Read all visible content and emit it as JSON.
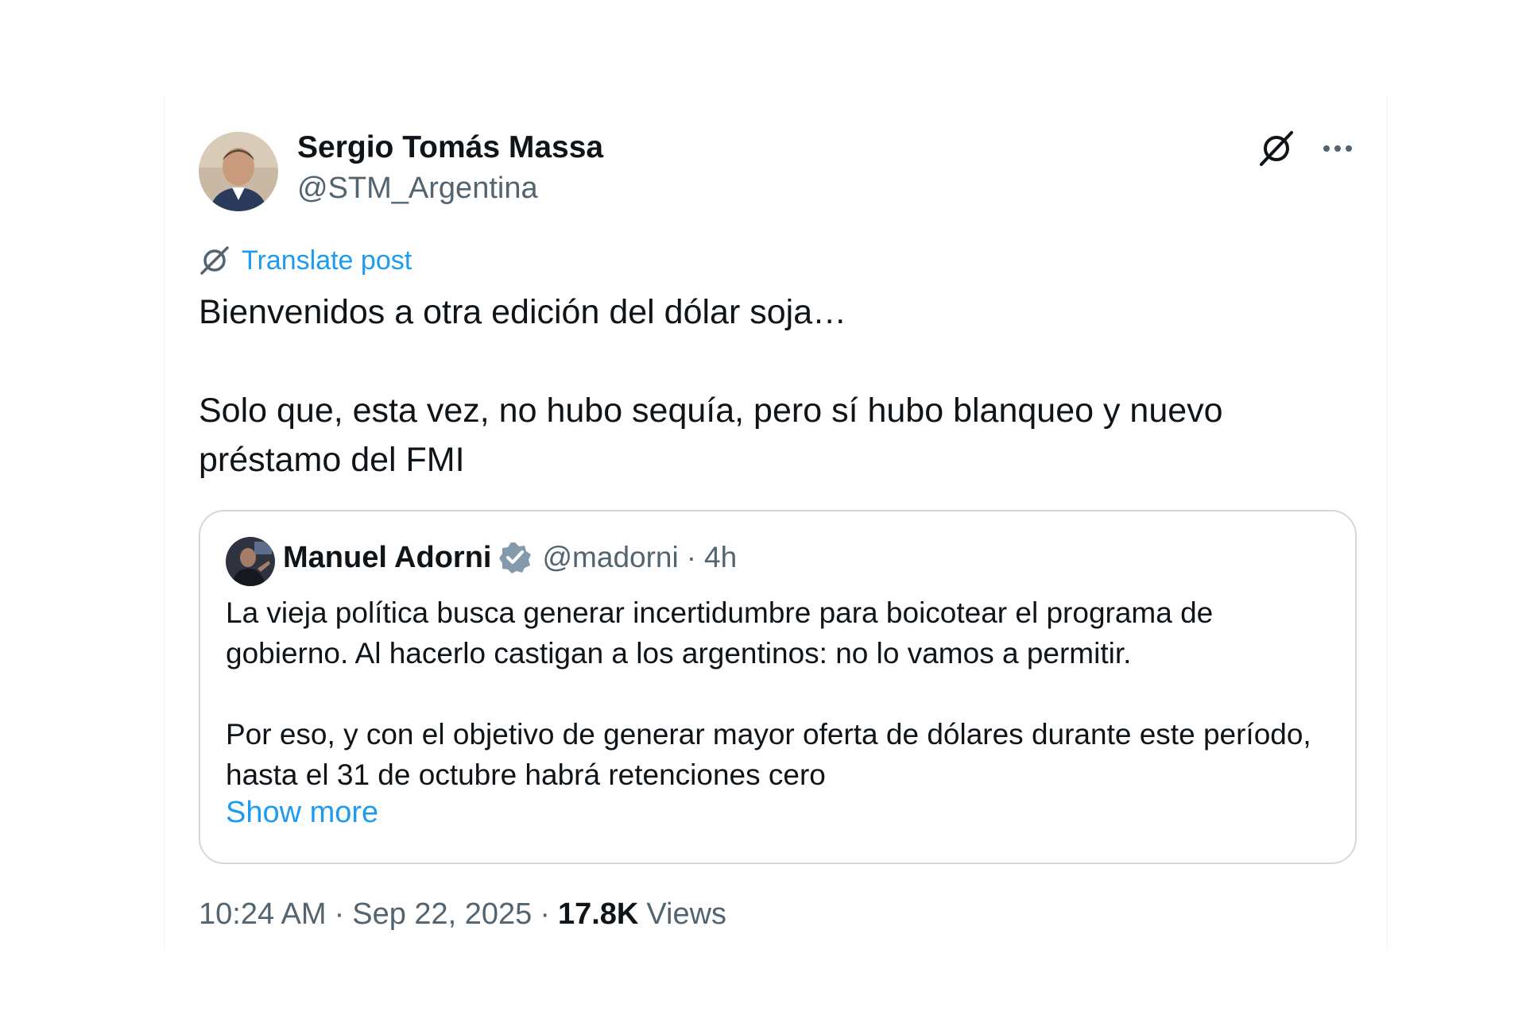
{
  "post": {
    "author": {
      "name": "Sergio Tomás Massa",
      "handle": "@STM_Argentina"
    },
    "translate_label": "Translate post",
    "text_paragraphs": [
      "Bienvenidos a otra edición del dólar soja…",
      "Solo que, esta vez, no hubo sequía, pero sí hubo blanqueo y nuevo préstamo del FMI"
    ],
    "time": "10:24 AM",
    "separator": "·",
    "date": "Sep 22, 2025",
    "views_count": "17.8K",
    "views_label": "Views"
  },
  "quote": {
    "author": {
      "name": "Manuel Adorni",
      "handle": "@madorni",
      "verified": true
    },
    "separator": "·",
    "time": "4h",
    "text_paragraphs": [
      "La vieja política busca generar incertidumbre para boicotear el programa de gobierno. Al hacerlo castigan a los argentinos: no lo vamos a permitir.",
      "Por eso, y con el objetivo de generar mayor oferta de dólares durante este período, hasta el 31 de octubre habrá retenciones cero"
    ],
    "show_more_label": "Show more"
  },
  "icons": {
    "grok": "grok-icon",
    "more": "more-horizontal-icon",
    "translate": "translate-icon",
    "verified": "verified-badge-icon"
  },
  "colors": {
    "text_primary": "#0f1419",
    "text_secondary": "#536471",
    "link": "#1d9bf0",
    "border": "#cfd9de",
    "verified_badge": "#829aab"
  }
}
